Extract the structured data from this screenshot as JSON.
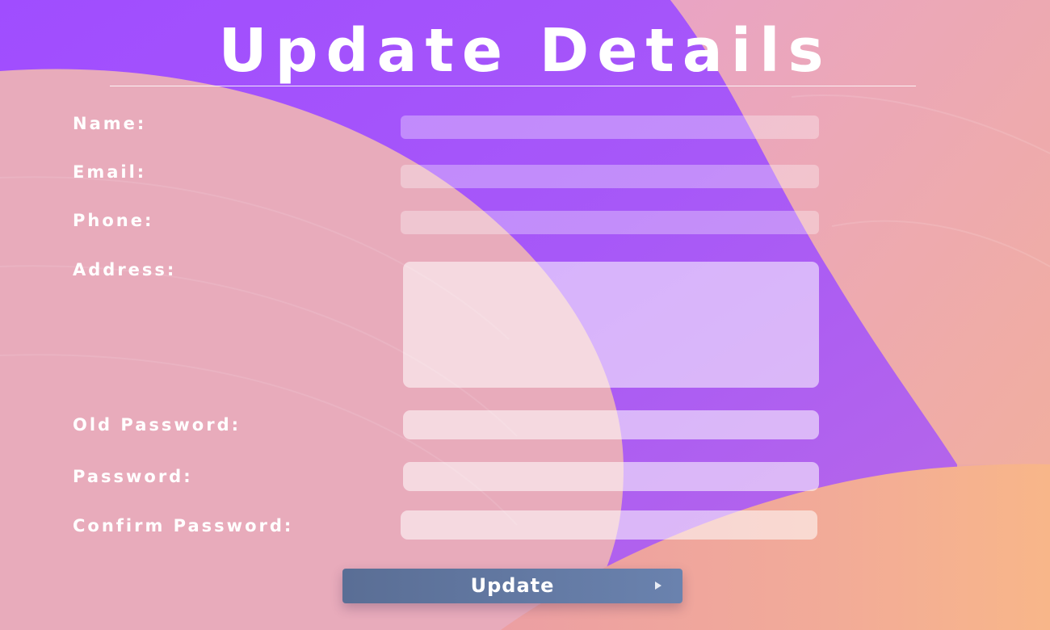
{
  "form": {
    "title": "Update Details",
    "fields": [
      {
        "label": "Name:",
        "value": ""
      },
      {
        "label": "Email:",
        "value": ""
      },
      {
        "label": "Phone:",
        "value": ""
      },
      {
        "label": "Address:",
        "value": ""
      },
      {
        "label": "Old Password:",
        "value": ""
      },
      {
        "label": "Password:",
        "value": ""
      },
      {
        "label": "Confirm Password:",
        "value": ""
      }
    ],
    "submit_label": "Update",
    "submit_icon": "play-arrow-icon"
  },
  "colors": {
    "background_pink": "#e8a9b3",
    "background_purple": "#a855ff",
    "background_orange": "#f8b48c",
    "button": "#5f77a3",
    "text": "#ffffff"
  }
}
